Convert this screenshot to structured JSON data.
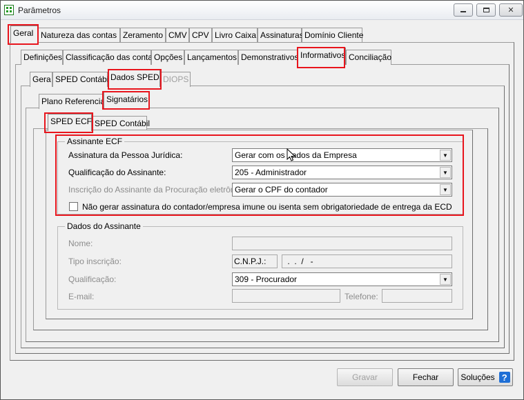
{
  "window": {
    "title": "Parâmetros"
  },
  "tabs_level1": [
    "Geral",
    "Natureza das contas",
    "Zeramento",
    "CMV",
    "CPV",
    "Livro Caixa",
    "Assinaturas",
    "Domínio Cliente"
  ],
  "tabs_level2": [
    "Definições",
    "Classificação das contas",
    "Opções",
    "Lançamentos",
    "Demonstrativos",
    "Informativos",
    "Conciliação"
  ],
  "tabs_level3": [
    "Gera",
    "SPED Contábil",
    "Dados SPED",
    "DIOPS"
  ],
  "tabs_level4": [
    "Plano Referencial",
    "Signatários"
  ],
  "tabs_level5": [
    "SPED ECF",
    "SPED Contábil"
  ],
  "assinante_ecf": {
    "legend": "Assinante ECF",
    "assinatura_label": "Assinatura da Pessoa Jurídica:",
    "assinatura_value": "Gerar com os dados da Empresa",
    "qualificacao_label": "Qualificação do Assinante:",
    "qualificacao_value": "205 - Administrador",
    "procuracao_label": "Inscrição do Assinante da Procuração eletrônica:",
    "procuracao_value": "Gerar o CPF do contador",
    "checkbox_label": "Não gerar assinatura do contador/empresa imune ou isenta sem obrigatoriedade de entrega da ECD"
  },
  "dados_assinante": {
    "legend": "Dados do Assinante",
    "nome_label": "Nome:",
    "nome_value": "",
    "tipo_label": "Tipo inscrição:",
    "tipo_value": "C.N.P.J.:",
    "cnpj_value": " .  .  /   -",
    "qualificacao_label": "Qualificação:",
    "qualificacao_value": "309 - Procurador",
    "email_label": "E-mail:",
    "email_value": "",
    "telefone_label": "Telefone:",
    "telefone_value": ""
  },
  "buttons": {
    "gravar": "Gravar",
    "fechar": "Fechar",
    "solucoes": "Soluções"
  },
  "icons": {
    "app": "spreadsheet-icon",
    "help": "help-icon",
    "minimize": "minimize-icon",
    "maximize": "maximize-icon",
    "close": "close-icon",
    "dropdown": "chevron-down-icon"
  },
  "colors": {
    "highlight": "#e8141c",
    "help_icon": "#1e6fd6"
  }
}
